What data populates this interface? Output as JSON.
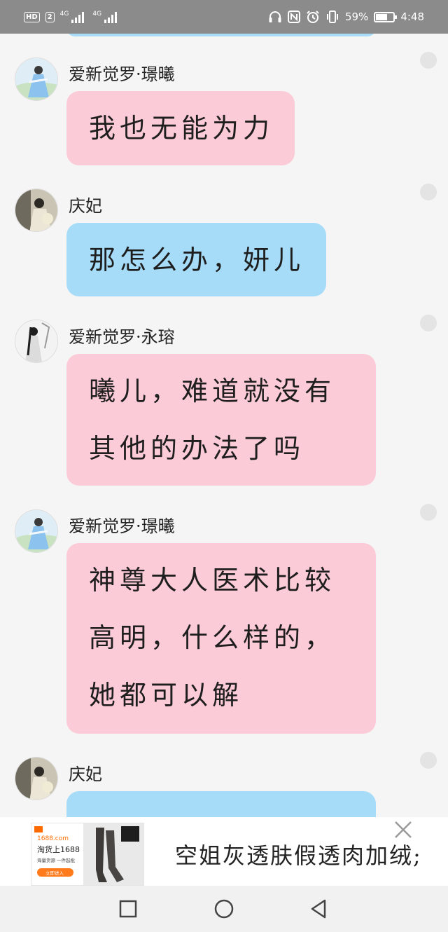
{
  "status_bar": {
    "hd_label": "HD",
    "sim_label": "2",
    "network_1": "4G",
    "network_2": "4G",
    "battery_percent": "59%",
    "battery_level": 0.59,
    "time": "4:48"
  },
  "messages": [
    {
      "sender": "爱新觉罗·璟曦",
      "bubble_color": "pink",
      "lines": [
        "我也无能为力"
      ]
    },
    {
      "sender": "庆妃",
      "bubble_color": "blue",
      "lines": [
        "那怎么办，妍儿"
      ]
    },
    {
      "sender": "爱新觉罗·永瑢",
      "bubble_color": "pink",
      "lines": [
        "曦儿，难道就没有",
        "其他的办法了吗"
      ]
    },
    {
      "sender": "爱新觉罗·璟曦",
      "bubble_color": "pink",
      "lines": [
        "神尊大人医术比较",
        "高明，什么样的，",
        "她都可以解"
      ]
    },
    {
      "sender": "庆妃",
      "bubble_color": "blue",
      "lines": []
    }
  ],
  "ad": {
    "site": "1688.com",
    "image_headline": "淘货上1688",
    "image_subline": "海量货源 一件起批",
    "image_button": "立即进入",
    "text": "空姐灰透肤假透肉加绒;"
  },
  "colors": {
    "pink_bubble": "#fccbd8",
    "blue_bubble": "#a6dcf8",
    "status_bar": "#8b8b8b"
  }
}
